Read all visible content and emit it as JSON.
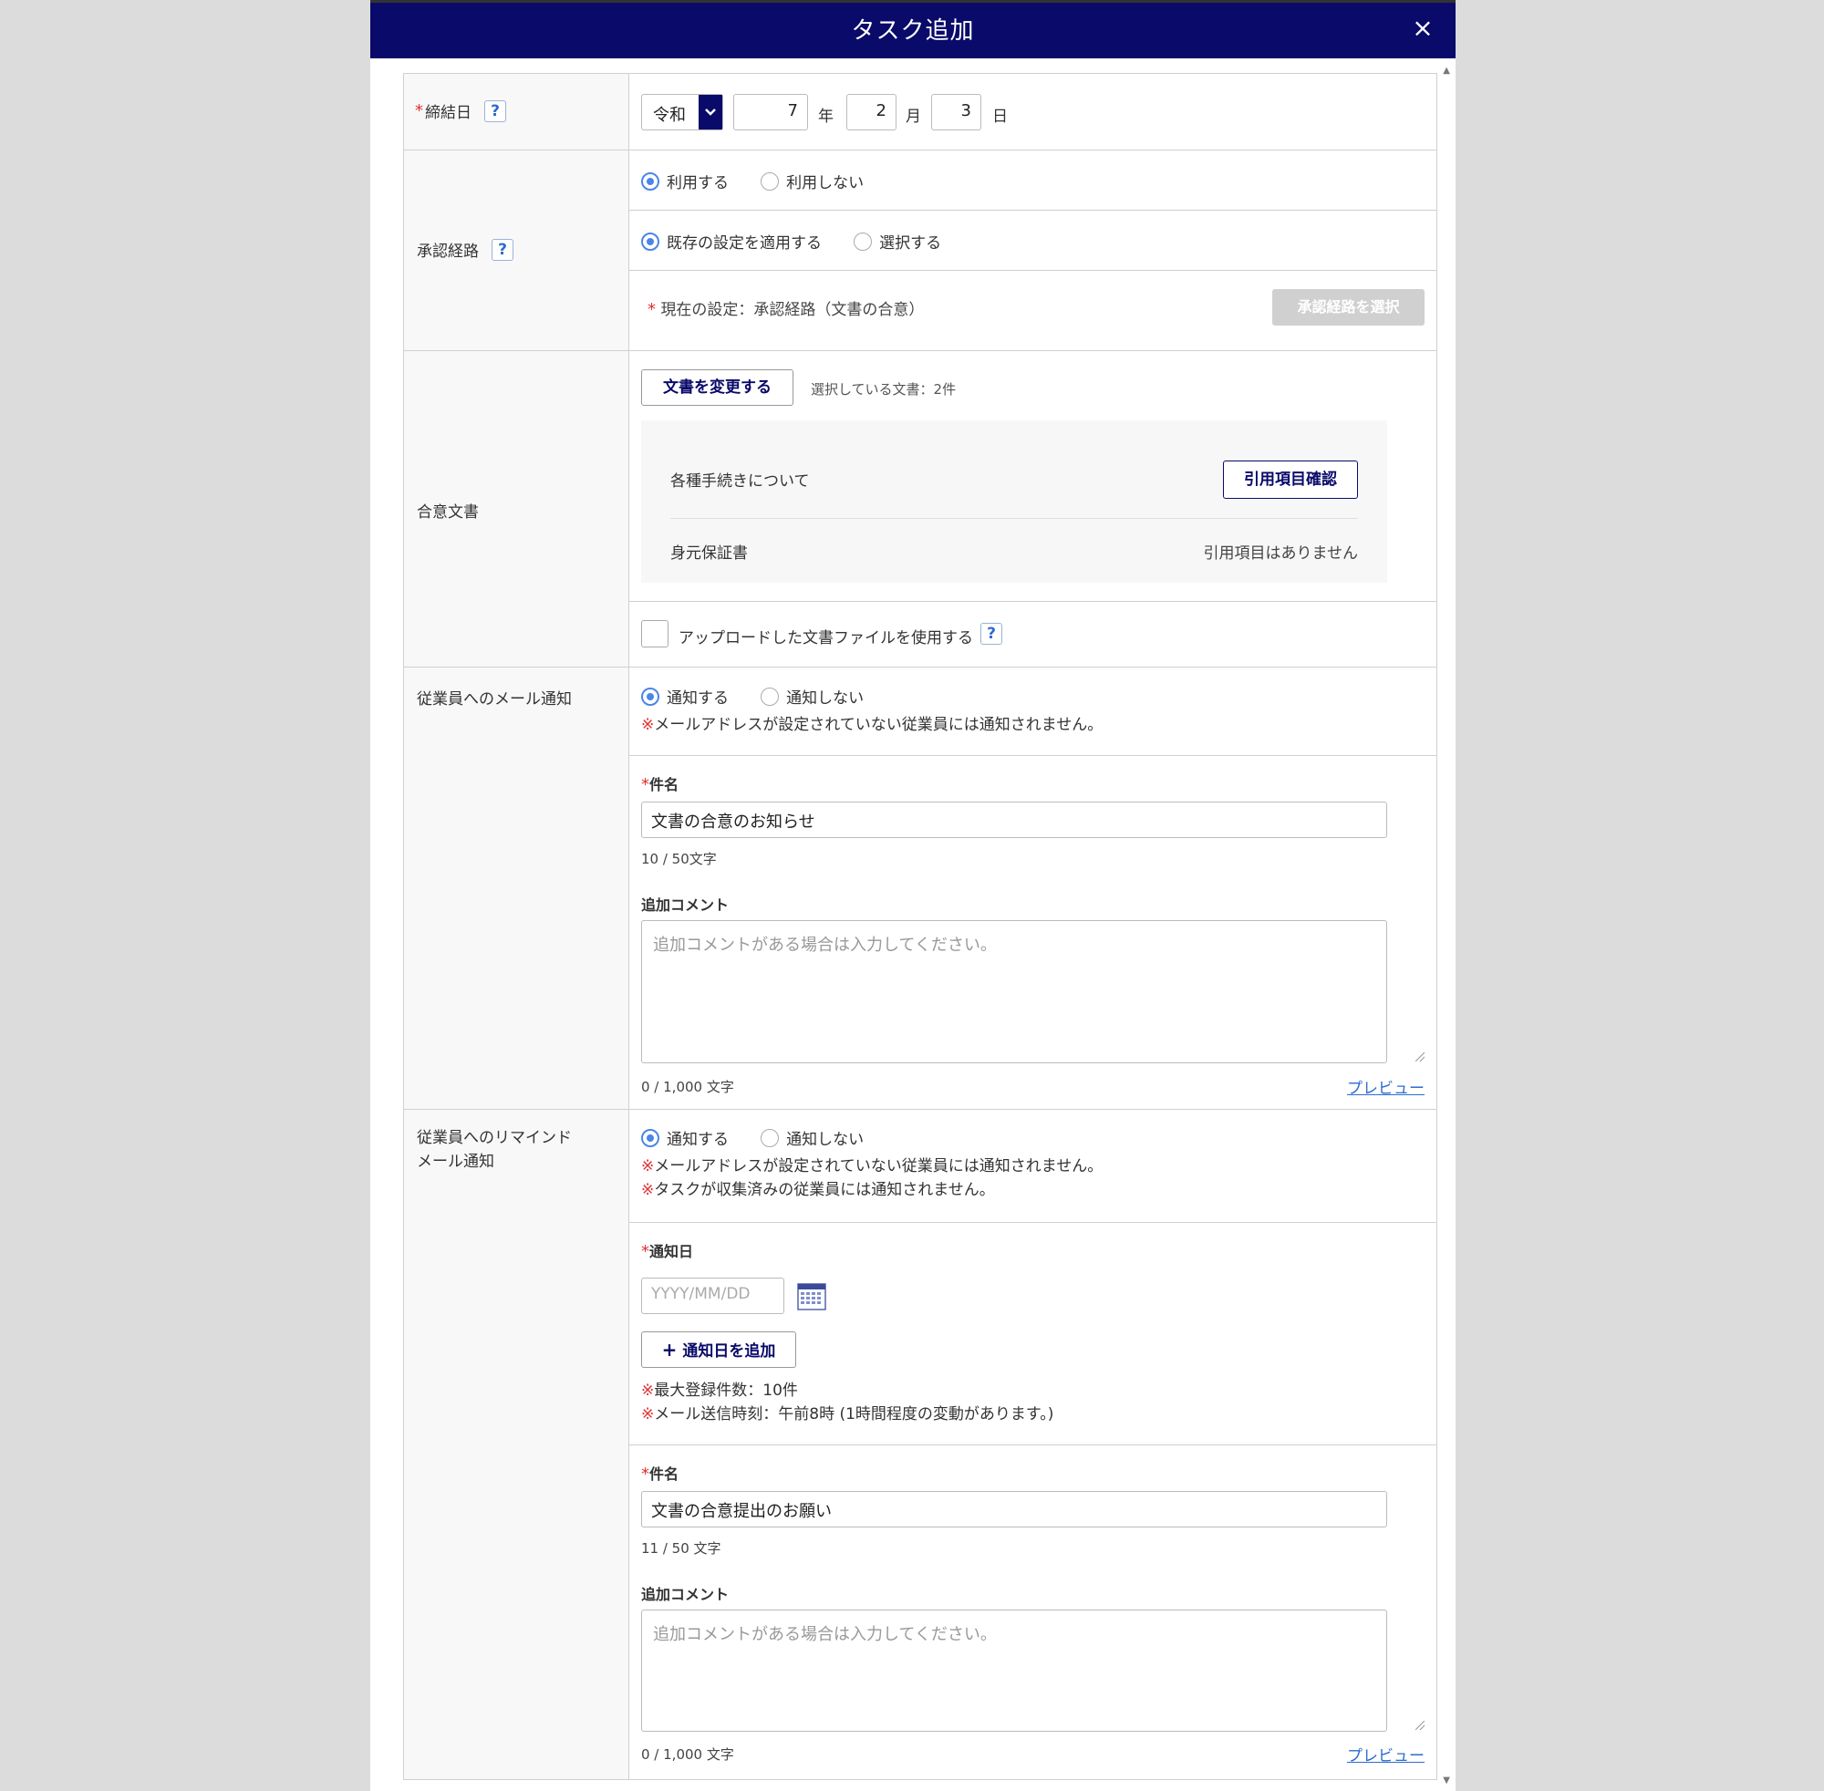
{
  "modal": {
    "title": "タスク追加",
    "close_label": "×"
  },
  "deadline": {
    "label": "締結日",
    "era": "令和",
    "year": "7",
    "year_unit": "年",
    "month": "2",
    "month_unit": "月",
    "day": "3",
    "day_unit": "日"
  },
  "approval": {
    "label": "承認経路",
    "use_options": [
      "利用する",
      "利用しない"
    ],
    "use_selected": 0,
    "route_options": [
      "既存の設定を適用する",
      "選択する"
    ],
    "route_selected": 0,
    "current": "現在の設定：承認経路（文書の合意）",
    "select_button": "承認経路を選択"
  },
  "documents": {
    "label": "合意文書",
    "change_button": "文書を変更する",
    "selected_count": "選択している文書：2件",
    "items": [
      {
        "name": "各種手続きについて",
        "action": "引用項目確認"
      },
      {
        "name": "身元保証書",
        "status": "引用項目はありません"
      }
    ],
    "upload_label": "アップロードした文書ファイルを使用する"
  },
  "mail_notice": {
    "label": "従業員へのメール通知",
    "options": [
      "通知する",
      "通知しない"
    ],
    "selected": 0,
    "note_mark": "※",
    "note": "メールアドレスが設定されていない従業員には通知されません。",
    "subject_label": "件名",
    "subject_value": "文書の合意のお知らせ",
    "subject_counter": "10 / 50文字",
    "comment_label": "追加コメント",
    "comment_placeholder": "追加コメントがある場合は入力してください。",
    "comment_counter": "0 / 1,000 文字",
    "preview": "プレビュー"
  },
  "remind_notice": {
    "label_line1": "従業員へのリマインド",
    "label_line2": "メール通知",
    "options": [
      "通知する",
      "通知しない"
    ],
    "selected": 0,
    "note_mark": "※",
    "notes": [
      "メールアドレスが設定されていない従業員には通知されません。",
      "タスクが収集済みの従業員には通知されません。"
    ],
    "date_label": "通知日",
    "date_placeholder": "YYYY/MM/DD",
    "add_date_button": "通知日を追加",
    "date_notes": [
      "最大登録件数：10件",
      "メール送信時刻：午前8時 (1時間程度の変動があります。)"
    ],
    "subject_label": "件名",
    "subject_value": "文書の合意提出のお願い",
    "subject_counter": "11 / 50 文字",
    "comment_label": "追加コメント",
    "comment_placeholder": "追加コメントがある場合は入力してください。",
    "comment_counter": "0 / 1,000 文字",
    "preview": "プレビュー"
  },
  "colors": {
    "header": "#0a0a6a",
    "accent": "#4a86e8",
    "required": "#e03030",
    "link": "#2d6bd0"
  },
  "icons": {
    "help": "question-icon",
    "calendar": "calendar-icon",
    "close": "close-icon",
    "dropdown": "chevron-down-icon",
    "add": "plus-icon"
  }
}
